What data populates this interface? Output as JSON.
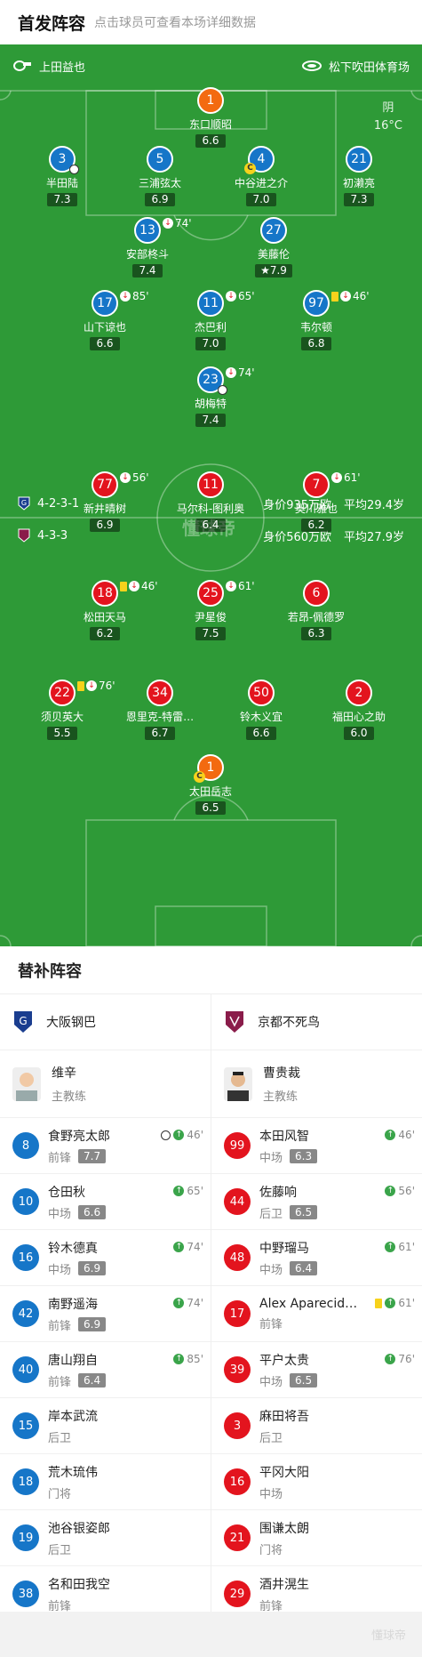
{
  "header": {
    "title": "首发阵容",
    "subtitle": "点击球员可查看本场详细数据"
  },
  "home": {
    "coach_label": "上田益也",
    "stadium": "松下吹田体育场"
  },
  "weather": {
    "condition": "阴",
    "temp": "16°C"
  },
  "watermark": "懂球帝",
  "gamba_info": {
    "formation": "4-2-3-1",
    "value": "身价935万欧",
    "age": "平均29.4岁"
  },
  "kyoto_info": {
    "formation": "4-3-3",
    "value": "身价560万欧",
    "age": "平均27.9岁"
  },
  "gamba_players": [
    {
      "num": "1",
      "name": "东口顺昭",
      "rating": "6.6",
      "color": "orange"
    },
    {
      "num": "3",
      "name": "半田陆",
      "rating": "7.3",
      "color": "blue"
    },
    {
      "num": "5",
      "name": "三浦弦太",
      "rating": "6.9",
      "color": "blue"
    },
    {
      "num": "4",
      "name": "中谷进之介",
      "rating": "7.0",
      "color": "blue"
    },
    {
      "num": "21",
      "name": "初濑亮",
      "rating": "7.3",
      "color": "blue"
    },
    {
      "num": "13",
      "name": "安部柊斗",
      "rating": "7.4",
      "color": "blue",
      "sub": "74'"
    },
    {
      "num": "27",
      "name": "美藤伦",
      "rating": "7.9",
      "color": "blue"
    },
    {
      "num": "17",
      "name": "山下谅也",
      "rating": "6.6",
      "color": "blue",
      "sub": "85'"
    },
    {
      "num": "11",
      "name": "杰巴利",
      "rating": "7.0",
      "color": "blue",
      "sub": "65'"
    },
    {
      "num": "97",
      "name": "韦尔顿",
      "rating": "6.8",
      "color": "blue",
      "sub": "46'"
    },
    {
      "num": "23",
      "name": "胡梅特",
      "rating": "7.4",
      "color": "blue",
      "sub": "74'"
    }
  ],
  "kyoto_players": [
    {
      "num": "77",
      "name": "新井晴树",
      "rating": "6.9",
      "color": "red",
      "sub": "56'"
    },
    {
      "num": "11",
      "name": "马尔科-图利奥",
      "rating": "6.4",
      "color": "red"
    },
    {
      "num": "7",
      "name": "奥川雅也",
      "rating": "6.2",
      "color": "red",
      "sub": "61'"
    },
    {
      "num": "18",
      "name": "松田天马",
      "rating": "6.2",
      "color": "red",
      "sub": "46'"
    },
    {
      "num": "25",
      "name": "尹星俊",
      "rating": "7.5",
      "color": "red",
      "sub": "61'"
    },
    {
      "num": "6",
      "name": "若昂-佩德罗",
      "rating": "6.3",
      "color": "red"
    },
    {
      "num": "22",
      "name": "须贝英大",
      "rating": "5.5",
      "color": "red",
      "sub": "76'"
    },
    {
      "num": "34",
      "name": "恩里克-特雷…",
      "rating": "6.7",
      "color": "red"
    },
    {
      "num": "50",
      "name": "铃木义宜",
      "rating": "6.6",
      "color": "red"
    },
    {
      "num": "2",
      "name": "福田心之助",
      "rating": "6.0",
      "color": "red"
    },
    {
      "num": "1",
      "name": "太田岳志",
      "rating": "6.5",
      "color": "orange"
    }
  ],
  "bench": {
    "title": "替补阵容",
    "left_team": "大阪钢巴",
    "right_team": "京都不死鸟",
    "left_coach": {
      "name": "维辛",
      "role": "主教练"
    },
    "right_coach": {
      "name": "曹贵裁",
      "role": "主教练"
    },
    "left": [
      {
        "num": "8",
        "name": "食野亮太郎",
        "pos": "前锋",
        "rating": "7.7",
        "time": "46'",
        "goal": true
      },
      {
        "num": "10",
        "name": "仓田秋",
        "pos": "中场",
        "rating": "6.6",
        "time": "65'"
      },
      {
        "num": "16",
        "name": "铃木德真",
        "pos": "中场",
        "rating": "6.9",
        "time": "74'"
      },
      {
        "num": "42",
        "name": "南野遥海",
        "pos": "前锋",
        "rating": "6.9",
        "time": "74'"
      },
      {
        "num": "40",
        "name": "唐山翔自",
        "pos": "前锋",
        "rating": "6.4",
        "time": "85'"
      },
      {
        "num": "15",
        "name": "岸本武流",
        "pos": "后卫",
        "rating": "",
        "time": ""
      },
      {
        "num": "18",
        "name": "荒木琉伟",
        "pos": "门将",
        "rating": "",
        "time": ""
      },
      {
        "num": "19",
        "name": "池谷银姿郎",
        "pos": "后卫",
        "rating": "",
        "time": ""
      },
      {
        "num": "38",
        "name": "名和田我空",
        "pos": "前锋",
        "rating": "",
        "time": ""
      }
    ],
    "right": [
      {
        "num": "99",
        "name": "本田风智",
        "pos": "中场",
        "rating": "6.3",
        "time": "46'"
      },
      {
        "num": "44",
        "name": "佐藤响",
        "pos": "后卫",
        "rating": "6.5",
        "time": "56'"
      },
      {
        "num": "48",
        "name": "中野瑠马",
        "pos": "中场",
        "rating": "6.4",
        "time": "61'"
      },
      {
        "num": "17",
        "name": "Alex Aparecid…",
        "pos": "前锋",
        "rating": "",
        "time": "61'",
        "yellow": true
      },
      {
        "num": "39",
        "name": "平户太贵",
        "pos": "中场",
        "rating": "6.5",
        "time": "76'"
      },
      {
        "num": "3",
        "name": "麻田将吾",
        "pos": "后卫",
        "rating": "",
        "time": ""
      },
      {
        "num": "16",
        "name": "平冈大阳",
        "pos": "中场",
        "rating": "",
        "time": ""
      },
      {
        "num": "21",
        "name": "围谦太朗",
        "pos": "门将",
        "rating": "",
        "time": ""
      },
      {
        "num": "29",
        "name": "酒井滉生",
        "pos": "前锋",
        "rating": "",
        "time": ""
      }
    ]
  },
  "footer_watermark": "懂球帝"
}
